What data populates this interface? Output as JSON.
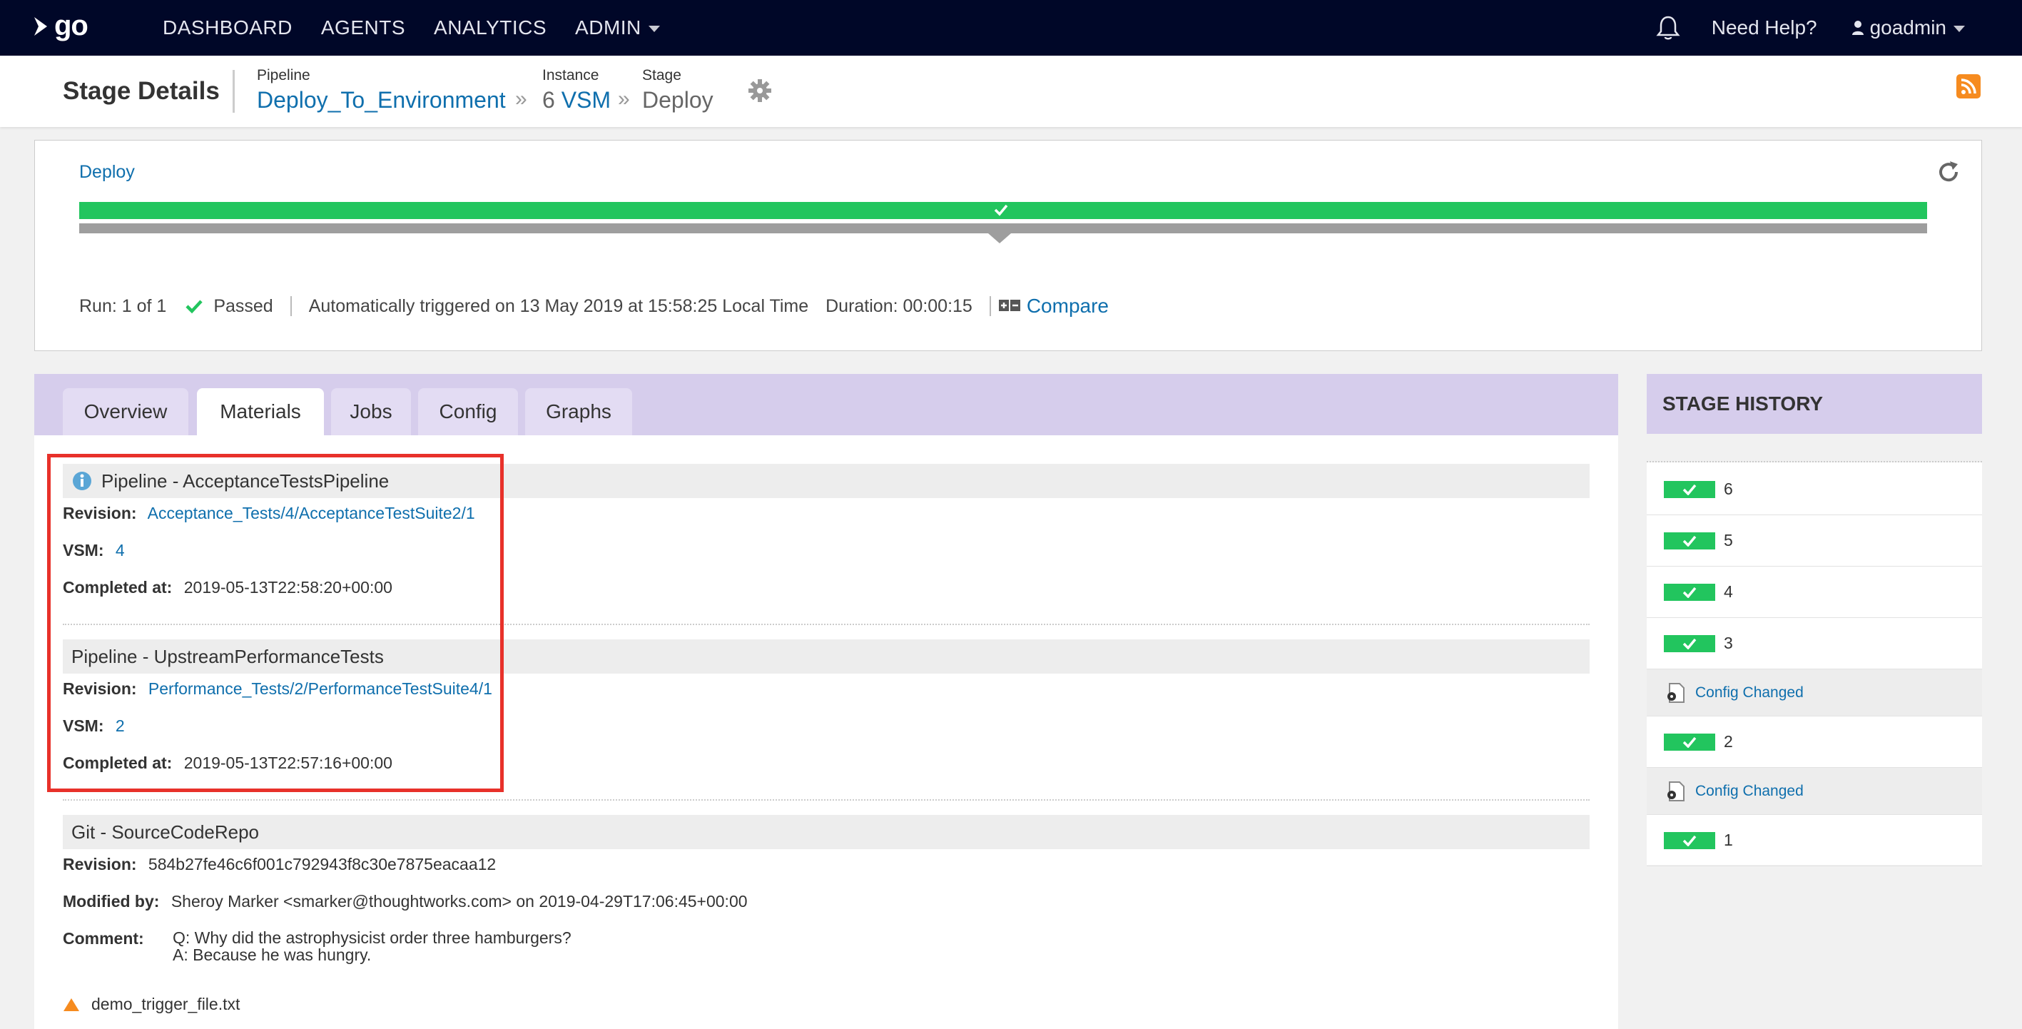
{
  "nav": {
    "logo_text": "go",
    "links": [
      "DASHBOARD",
      "AGENTS",
      "ANALYTICS",
      "ADMIN"
    ],
    "help": "Need Help?",
    "user": "goadmin"
  },
  "header": {
    "title": "Stage Details",
    "pipeline_label": "Pipeline",
    "pipeline_value": "Deploy_To_Environment",
    "instance_label": "Instance",
    "instance_number": "6",
    "instance_vsm": "VSM",
    "stage_label": "Stage",
    "stage_value": "Deploy",
    "sep": "»"
  },
  "stage_panel": {
    "stage_name": "Deploy",
    "run": "Run: 1 of 1",
    "status": "Passed",
    "trigger": "Automatically triggered on 13 May 2019 at 15:58:25 Local Time",
    "duration": "Duration: 00:00:15",
    "compare": "Compare",
    "progress": 1.0
  },
  "tabs": [
    {
      "label": "Overview",
      "active": false
    },
    {
      "label": "Materials",
      "active": true
    },
    {
      "label": "Jobs",
      "active": false
    },
    {
      "label": "Config",
      "active": false
    },
    {
      "label": "Graphs",
      "active": false
    }
  ],
  "materials": [
    {
      "title": "Pipeline - AcceptanceTestsPipeline",
      "revision_label": "Revision:",
      "revision": "Acceptance_Tests/4/AcceptanceTestSuite2/1",
      "vsm_label": "VSM:",
      "vsm": "4",
      "completed_label": "Completed at:",
      "completed": "2019-05-13T22:58:20+00:00"
    },
    {
      "title": "Pipeline - UpstreamPerformanceTests",
      "revision_label": "Revision:",
      "revision": "Performance_Tests/2/PerformanceTestSuite4/1",
      "vsm_label": "VSM:",
      "vsm": "2",
      "completed_label": "Completed at:",
      "completed": "2019-05-13T22:57:16+00:00"
    },
    {
      "title": "Git - SourceCodeRepo",
      "revision_label": "Revision:",
      "revision": "584b27fe46c6f001c792943f8c30e7875eacaa12",
      "modified_label": "Modified by:",
      "modified": "Sheroy Marker <smarker@thoughtworks.com> on 2019-04-29T17:06:45+00:00",
      "comment_label": "Comment:",
      "comment": "Q: Why did the astrophysicist order three hamburgers?\nA: Because he was hungry.",
      "file": "demo_trigger_file.txt"
    }
  ],
  "history": {
    "title": "STAGE HISTORY",
    "items": [
      {
        "type": "run",
        "label": "6"
      },
      {
        "type": "run",
        "label": "5"
      },
      {
        "type": "run",
        "label": "4"
      },
      {
        "type": "run",
        "label": "3"
      },
      {
        "type": "config",
        "label": "Config Changed"
      },
      {
        "type": "run",
        "label": "2"
      },
      {
        "type": "config",
        "label": "Config Changed"
      },
      {
        "type": "run",
        "label": "1"
      }
    ]
  },
  "colors": {
    "nav_bg": "#000728",
    "link": "#0f6fad",
    "passed": "#22c55e",
    "tab_strip": "#d6cdec",
    "highlight": "#e8312a"
  }
}
